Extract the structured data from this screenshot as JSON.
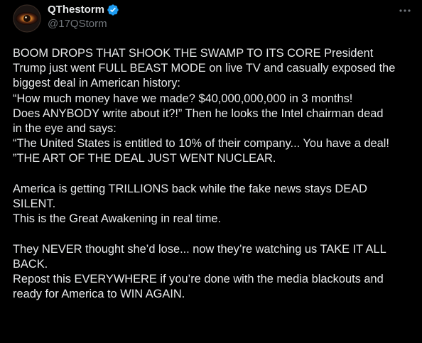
{
  "post": {
    "author": {
      "display_name": "QThestorm",
      "handle": "@17QStorm",
      "verified_icon": "verified-badge-icon",
      "avatar_icon": "eye-avatar-icon"
    },
    "more_icon": "more-options-icon",
    "lines": [
      "BOOM DROPS THAT SHOOK THE SWAMP TO ITS CORE President",
      "Trump just went FULL BEAST MODE on live TV and casually exposed the",
      "biggest deal in American history:",
      "“How much money have we made? $40,000,000,000 in 3 months!",
      "Does ANYBODY write about it?!” Then he looks the Intel chairman dead",
      "in the eye and says:",
      "“The United States is entitled to 10% of their company... You have a deal!",
      "”THE ART OF THE DEAL JUST WENT NUCLEAR.",
      "",
      "America is getting TRILLIONS back while the fake news stays DEAD",
      "SILENT.",
      "This is the Great Awakening in real time.",
      "",
      "They NEVER thought she’d lose... now they’re watching us TAKE IT ALL",
      "BACK.",
      "Repost this EVERYWHERE if you’re done with the media blackouts and",
      "ready for America to WIN AGAIN."
    ]
  },
  "colors": {
    "background": "#000000",
    "text": "#e7e9ea",
    "secondary_text": "#71767b",
    "verified_blue": "#1d9bf0"
  }
}
